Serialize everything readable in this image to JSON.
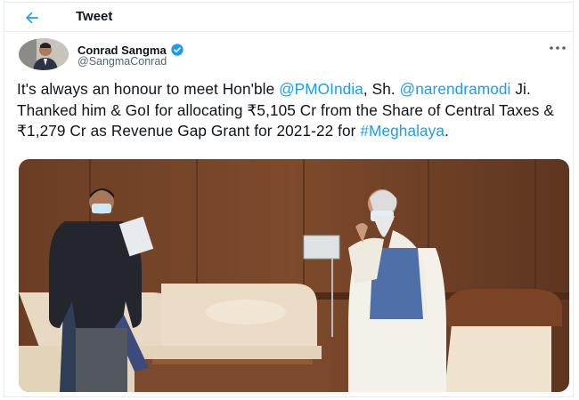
{
  "header": {
    "title": "Tweet"
  },
  "author": {
    "name": "Conrad Sangma",
    "handle": "@SangmaConrad"
  },
  "tweet": {
    "segments": [
      {
        "text": "It's always an honour to meet Hon'ble ",
        "link": false
      },
      {
        "text": "@PMOIndia",
        "link": true
      },
      {
        "text": ", Sh. ",
        "link": false
      },
      {
        "text": "@narendramodi",
        "link": true
      },
      {
        "text": " Ji. Thanked him & GoI for allocating ₹5,105 Cr from the Share of Central Taxes & ₹1,279 Cr as Revenue Gap Grant for 2021-22 for ",
        "link": false
      },
      {
        "text": "#Meghalaya",
        "link": true
      },
      {
        "text": ".",
        "link": false
      }
    ]
  },
  "colors": {
    "link": "#1d9bf0",
    "verified": "#1d9bf0",
    "text": "#0f1419",
    "secondary": "#536471"
  },
  "icons": {
    "back": "arrow-left-icon",
    "verified": "verified-badge-icon",
    "more": "more-horizontal-icon"
  }
}
